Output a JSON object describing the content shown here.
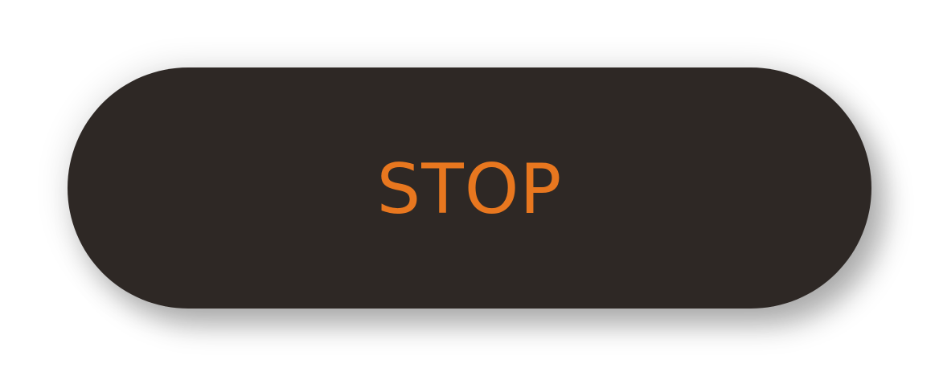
{
  "button": {
    "label": "STOP",
    "background_color": "#2e2825",
    "text_color": "#e8771f"
  }
}
